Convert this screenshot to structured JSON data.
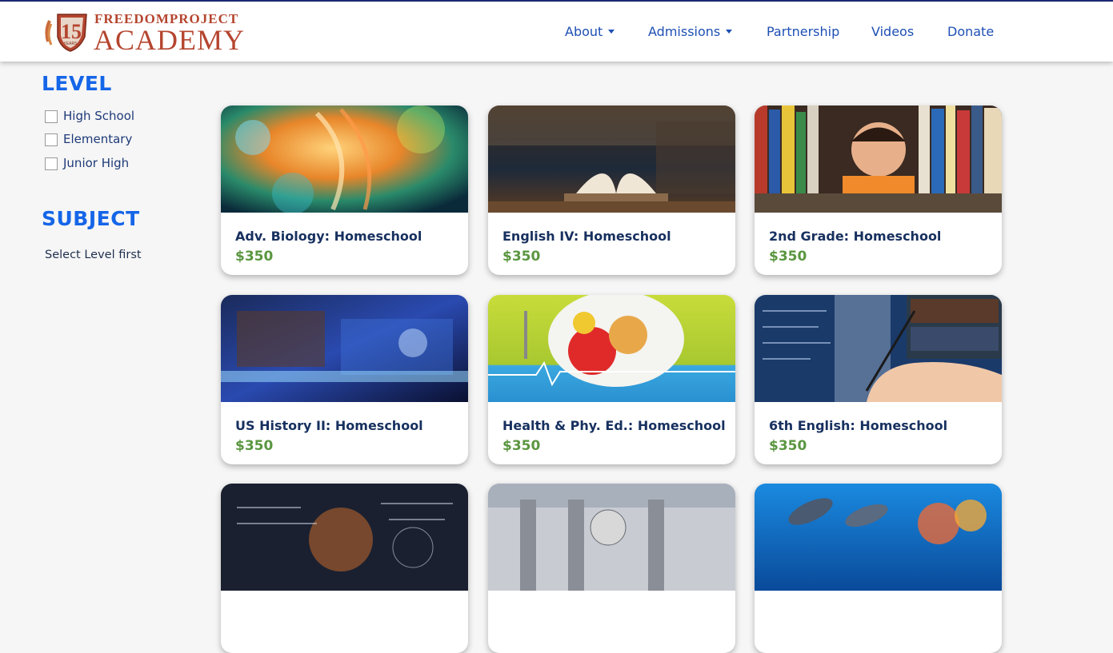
{
  "header": {
    "logo": {
      "line1": "FREEDOMPROJECT",
      "line2": "ACADEMY",
      "badge_number": "15",
      "badge_text": "YEARS"
    },
    "nav": [
      {
        "label": "About",
        "dropdown": true
      },
      {
        "label": "Admissions",
        "dropdown": true
      },
      {
        "label": "Partnership",
        "dropdown": false
      },
      {
        "label": "Videos",
        "dropdown": false
      },
      {
        "label": "Donate",
        "dropdown": false
      }
    ]
  },
  "filters": {
    "level": {
      "heading": "LEVEL",
      "options": [
        "High School",
        "Elementary",
        "Junior High"
      ]
    },
    "subject": {
      "heading": "SUBJECT",
      "note": "Select Level first"
    }
  },
  "courses": [
    {
      "title": "Adv. Biology: Homeschool",
      "price": "$350",
      "image": "biology-dna-image"
    },
    {
      "title": "English IV: Homeschool",
      "price": "$350",
      "image": "open-book-image"
    },
    {
      "title": "2nd Grade: Homeschool",
      "price": "$350",
      "image": "boy-bookshelf-image"
    },
    {
      "title": "US History II: Homeschool",
      "price": "$350",
      "image": "history-collage-image"
    },
    {
      "title": "Health & Phy. Ed.: Homeschool",
      "price": "$350",
      "image": "health-food-image"
    },
    {
      "title": "6th English: Homeschool",
      "price": "$350",
      "image": "writing-hand-image"
    },
    {
      "title": "",
      "price": "",
      "image": "math-equations-image"
    },
    {
      "title": "",
      "price": "",
      "image": "architecture-statue-image"
    },
    {
      "title": "",
      "price": "",
      "image": "dolphins-reef-image"
    }
  ],
  "colors": {
    "nav_link": "#1e4fb4",
    "heading": "#1565e8",
    "price": "#5a9640",
    "logo": "#b5452f"
  }
}
